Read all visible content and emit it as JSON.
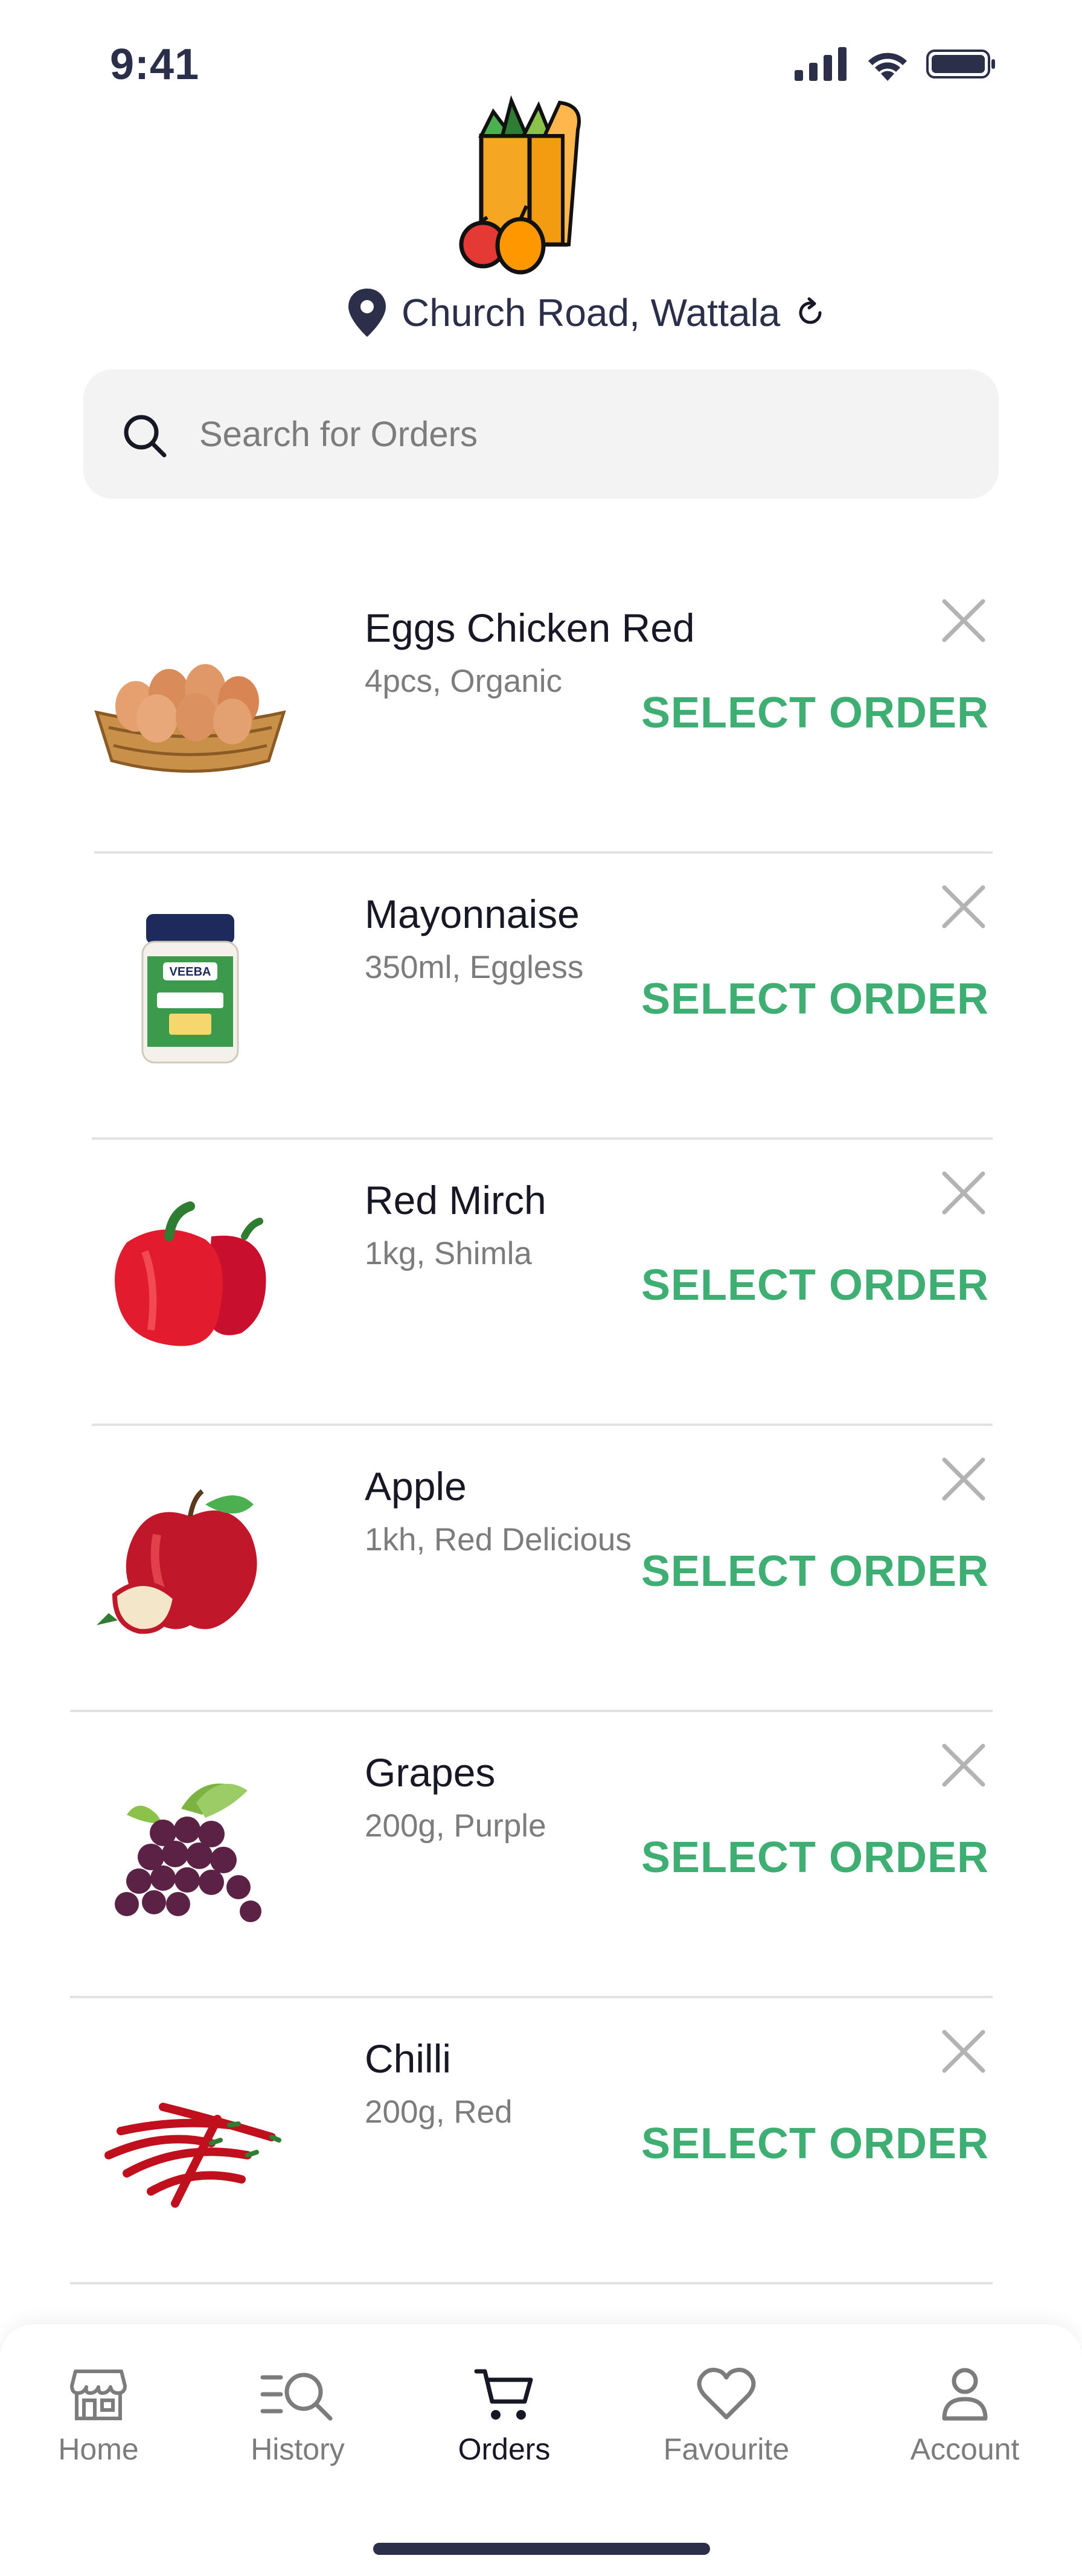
{
  "status": {
    "time": "9:41"
  },
  "location": {
    "text": "Church Road, Wattala"
  },
  "search": {
    "placeholder": "Search for Orders"
  },
  "items": [
    {
      "name": "Eggs Chicken Red",
      "desc": "4pcs, Organic",
      "action": "SELECT ORDER",
      "image": "eggs-basket"
    },
    {
      "name": "Mayonnaise",
      "desc": "350ml, Eggless",
      "action": "SELECT ORDER",
      "image": "mayonnaise-jar"
    },
    {
      "name": "Red Mirch",
      "desc": "1kg, Shimla",
      "action": "SELECT ORDER",
      "image": "red-bell-pepper"
    },
    {
      "name": "Apple",
      "desc": "1kh, Red Delicious",
      "action": "SELECT ORDER",
      "image": "red-apple"
    },
    {
      "name": "Grapes",
      "desc": "200g, Purple",
      "action": "SELECT ORDER",
      "image": "purple-grapes"
    },
    {
      "name": "Chilli",
      "desc": "200g, Red",
      "action": "SELECT ORDER",
      "image": "red-chillies"
    }
  ],
  "tabs": [
    {
      "label": "Home",
      "icon": "store-icon",
      "active": false
    },
    {
      "label": "History",
      "icon": "history-search-icon",
      "active": false
    },
    {
      "label": "Orders",
      "icon": "cart-icon",
      "active": true
    },
    {
      "label": "Favourite",
      "icon": "heart-icon",
      "active": false
    },
    {
      "label": "Account",
      "icon": "user-icon",
      "active": false
    }
  ],
  "colors": {
    "accent": "#3fae73",
    "navy": "#2b2f4a",
    "muted": "#7c7c7c",
    "search_bg": "#f2f3f2"
  }
}
